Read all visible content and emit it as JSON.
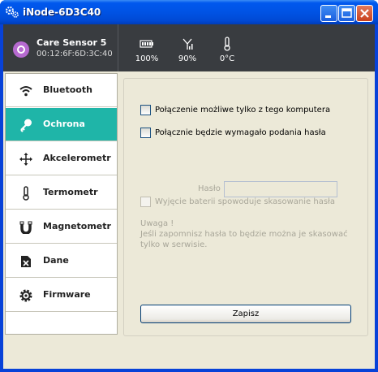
{
  "window": {
    "title": "iNode-6D3C40"
  },
  "device": {
    "name": "Care Sensor 5",
    "mac": "00:12:6F:6D:3C:40"
  },
  "status": {
    "battery": {
      "icon": "battery-icon",
      "value": "100%"
    },
    "signal": {
      "icon": "signal-icon",
      "value": "90%"
    },
    "temperature": {
      "icon": "thermometer-icon",
      "value": "0°C"
    }
  },
  "sidebar": {
    "items": [
      {
        "label": "Bluetooth",
        "icon": "wifi-icon"
      },
      {
        "label": "Ochrona",
        "icon": "key-icon",
        "active": true
      },
      {
        "label": "Akcelerometr",
        "icon": "move-arrows-icon"
      },
      {
        "label": "Termometr",
        "icon": "thermometer-icon"
      },
      {
        "label": "Magnetometr",
        "icon": "magnet-icon"
      },
      {
        "label": "Dane",
        "icon": "document-icon"
      },
      {
        "label": "Firmware",
        "icon": "gear-icon"
      }
    ]
  },
  "security": {
    "only_this_computer": "Połączenie możliwe tylko z tego komputera",
    "require_password": "Połącznie będzie wymagało podania hasła",
    "password_label": "Hasło",
    "password_value": "",
    "battery_reset": "Wyjęcie baterii spowoduje skasowanie hasła",
    "note_title": "Uwaga !",
    "note_line1": "Jeśli zapomnisz hasła to będzie można je skasować",
    "note_line2": "tylko w serwisie.",
    "save_label": "Zapisz"
  },
  "colors": {
    "accent": "#1fb5a8",
    "header_bg": "#393c40",
    "titlebar": "#0053e4"
  }
}
